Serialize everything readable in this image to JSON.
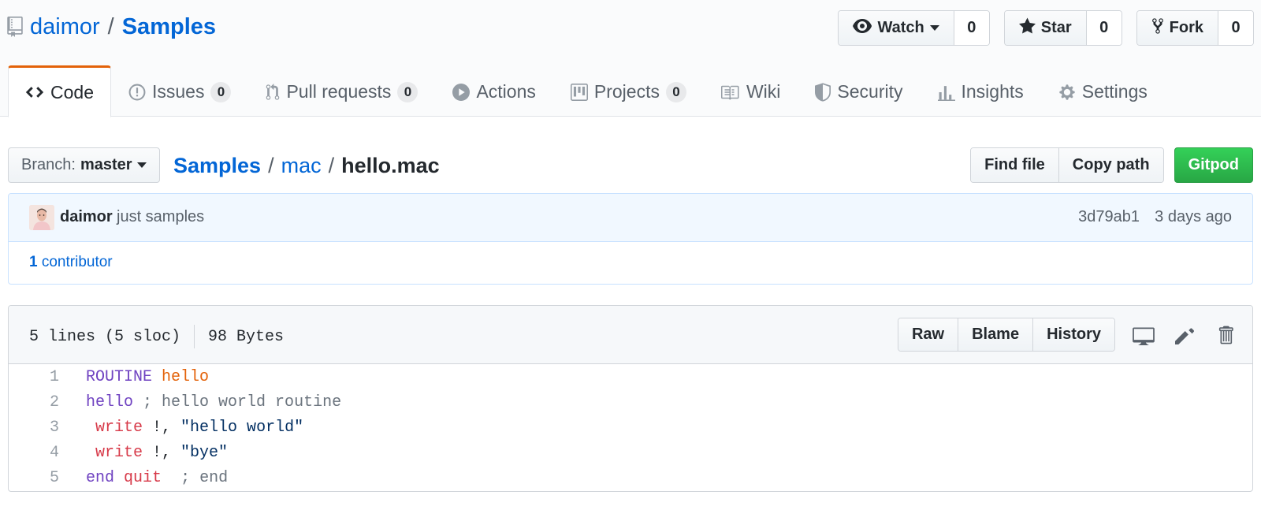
{
  "repo": {
    "owner": "daimor",
    "separator": "/",
    "name": "Samples"
  },
  "header_actions": {
    "watch": {
      "label": "Watch",
      "count": "0"
    },
    "star": {
      "label": "Star",
      "count": "0"
    },
    "fork": {
      "label": "Fork",
      "count": "0"
    }
  },
  "tabs": [
    {
      "label": "Code",
      "icon": "code-icon",
      "selected": true
    },
    {
      "label": "Issues",
      "icon": "issue-icon",
      "count": "0"
    },
    {
      "label": "Pull requests",
      "icon": "pull-request-icon",
      "count": "0"
    },
    {
      "label": "Actions",
      "icon": "play-icon"
    },
    {
      "label": "Projects",
      "icon": "project-icon",
      "count": "0"
    },
    {
      "label": "Wiki",
      "icon": "book-icon"
    },
    {
      "label": "Security",
      "icon": "shield-icon"
    },
    {
      "label": "Insights",
      "icon": "graph-icon"
    },
    {
      "label": "Settings",
      "icon": "gear-icon"
    }
  ],
  "file_nav": {
    "branch_prefix": "Branch:",
    "branch": "master",
    "breadcrumb": {
      "root": "Samples",
      "sep": "/",
      "folder": "mac",
      "file": "hello.mac"
    },
    "find_file": "Find file",
    "copy_path": "Copy path",
    "gitpod": "Gitpod"
  },
  "commit": {
    "author": "daimor",
    "message": "just samples",
    "sha": "3d79ab1",
    "time": "3 days ago",
    "contributors_count": "1",
    "contributors_label": "contributor"
  },
  "file": {
    "lines_info": "5 lines (5 sloc)",
    "size": "98 Bytes",
    "raw": "Raw",
    "blame": "Blame",
    "history": "History",
    "code": [
      {
        "n": "1",
        "tokens": [
          [
            "k",
            "ROUTINE"
          ],
          [
            "",
            " "
          ],
          [
            "o",
            "hello"
          ]
        ]
      },
      {
        "n": "2",
        "tokens": [
          [
            "k",
            "hello"
          ],
          [
            "",
            " "
          ],
          [
            "c",
            "; hello world routine"
          ]
        ]
      },
      {
        "n": "3",
        "tokens": [
          [
            "",
            " "
          ],
          [
            "r",
            "write"
          ],
          [
            "",
            " !, "
          ],
          [
            "s",
            "\"hello world\""
          ]
        ]
      },
      {
        "n": "4",
        "tokens": [
          [
            "",
            " "
          ],
          [
            "r",
            "write"
          ],
          [
            "",
            " !, "
          ],
          [
            "s",
            "\"bye\""
          ]
        ]
      },
      {
        "n": "5",
        "tokens": [
          [
            "k",
            "end"
          ],
          [
            "",
            " "
          ],
          [
            "r",
            "quit"
          ],
          [
            "",
            "  "
          ],
          [
            "c",
            "; end"
          ]
        ]
      }
    ]
  },
  "colors": {
    "link": "#0366d6",
    "tab_accent": "#e36209",
    "green_button": "#28a745"
  }
}
